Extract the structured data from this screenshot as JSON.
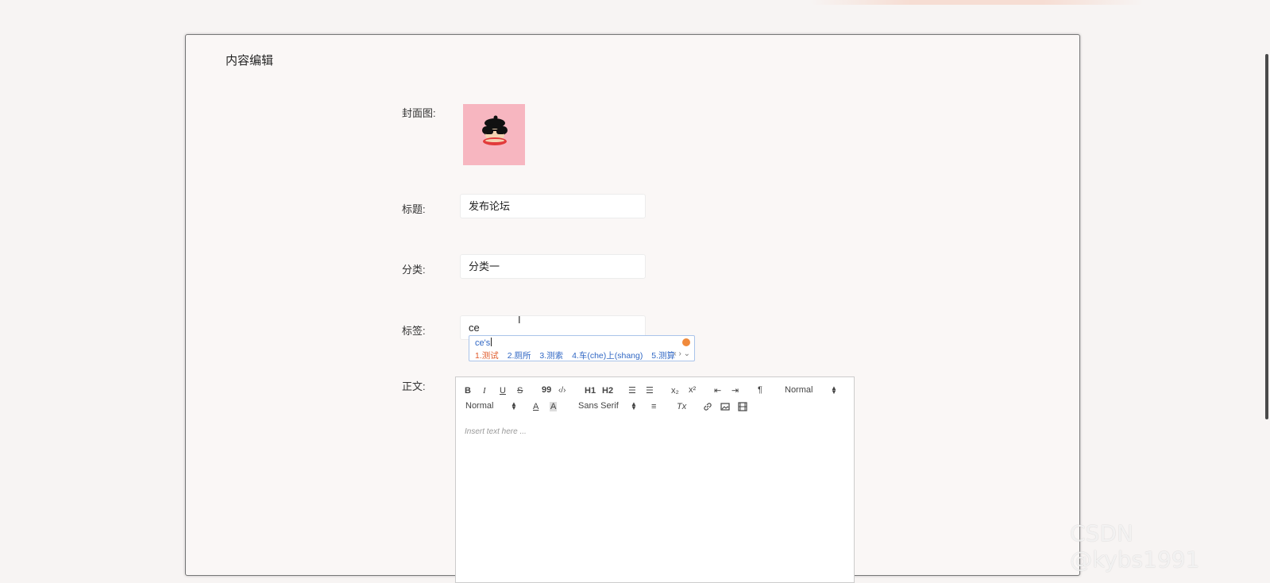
{
  "card": {
    "title": "内容编辑"
  },
  "form": {
    "cover_label": "封面图:",
    "title_label": "标题:",
    "title_value": "发布论坛",
    "category_label": "分类:",
    "category_value": "分类一",
    "tags_label": "标签:",
    "tags_value": "ce",
    "body_label": "正文:"
  },
  "ime": {
    "composition": "ce's",
    "candidates": [
      "1.测试",
      "2.厕所",
      "3.测索",
      "4.车(che)上(shang)",
      "5.测算"
    ],
    "nav": "‹ › ⌄"
  },
  "editor": {
    "toolbar": {
      "bold": "B",
      "italic": "I",
      "underline": "U",
      "strike": "S",
      "blockquote": "99",
      "code": "‹/›",
      "h1": "H1",
      "h2": "H2",
      "ordered_list": "☰",
      "bullet_list": "☰",
      "subscript": "x₂",
      "superscript": "x²",
      "outdent": "⇤",
      "indent": "⇥",
      "direction": "¶",
      "size_value": "Normal",
      "header_value": "Normal",
      "font_color": "A",
      "background": "A",
      "font_value": "Sans Serif",
      "align": "≡",
      "clean": "Tx"
    },
    "placeholder": "Insert text here ..."
  },
  "watermark": "CSDN @kybs1991",
  "colors": {
    "cover_bg": "#f7b6c0",
    "ime_highlight": "#e05a2a",
    "ime_text": "#3067c4"
  }
}
